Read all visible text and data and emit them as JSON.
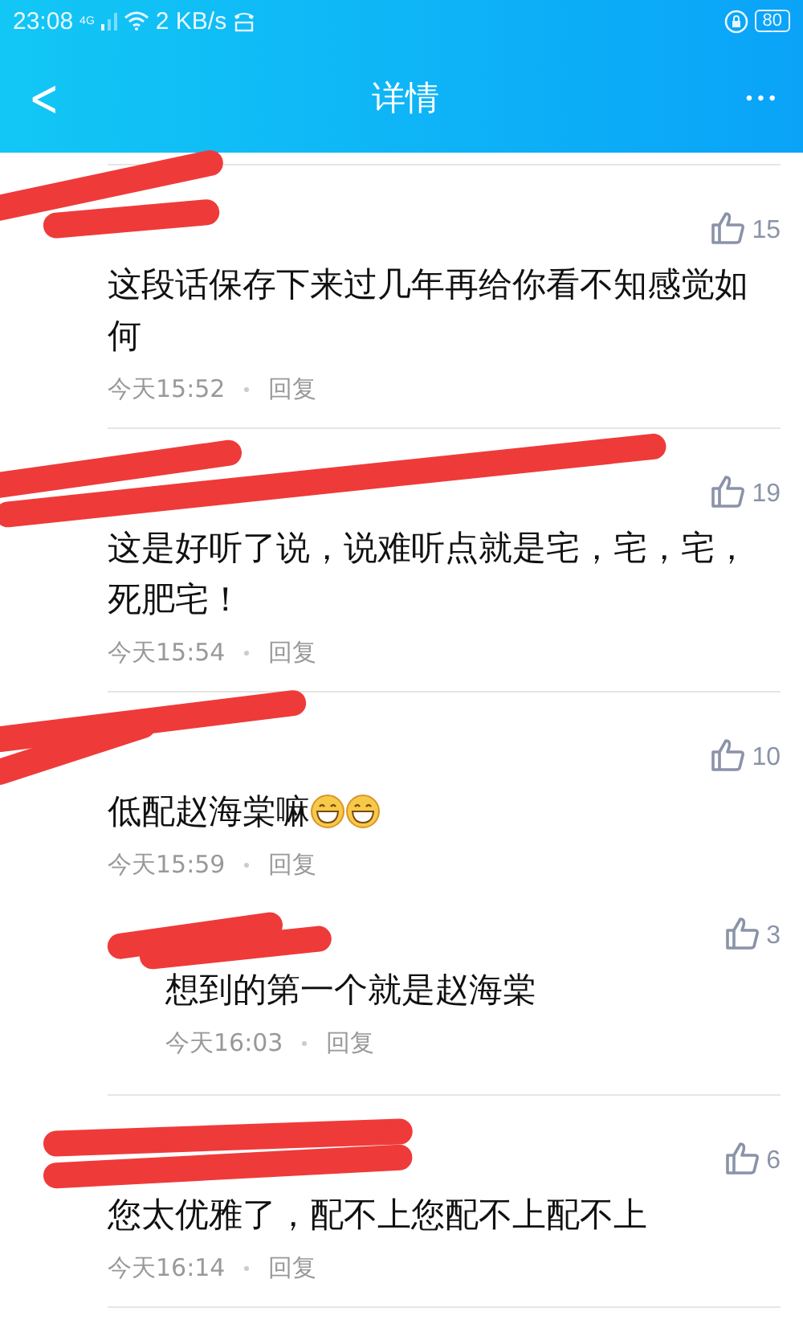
{
  "status_bar": {
    "time": "23:08",
    "network": "4G",
    "speed": "2 KB/s",
    "battery": "80"
  },
  "header": {
    "back": "<",
    "title": "详情",
    "more": "•••"
  },
  "comments": [
    {
      "kind": "comment",
      "likes": "15",
      "text": "这段话保存下来过几年再给你看不知感觉如何",
      "time": "今天15:52",
      "reply": "回复"
    },
    {
      "kind": "comment",
      "likes": "19",
      "text": "这是好听了说，说难听点就是宅，宅，宅，死肥宅！",
      "time": "今天15:54",
      "reply": "回复"
    },
    {
      "kind": "comment",
      "likes": "10",
      "text": "低配赵海棠嘛",
      "emojis": [
        {
          "kind": "grin"
        },
        {
          "kind": "grin"
        }
      ],
      "time": "今天15:59",
      "reply": "回复"
    },
    {
      "kind": "reply",
      "likes": "3",
      "text": "想到的第一个就是赵海棠",
      "time": "今天16:03",
      "reply": "回复"
    },
    {
      "kind": "comment",
      "likes": "6",
      "text": "您太优雅了，配不上您配不上配不上",
      "time": "今天16:14",
      "reply": "回复"
    }
  ]
}
